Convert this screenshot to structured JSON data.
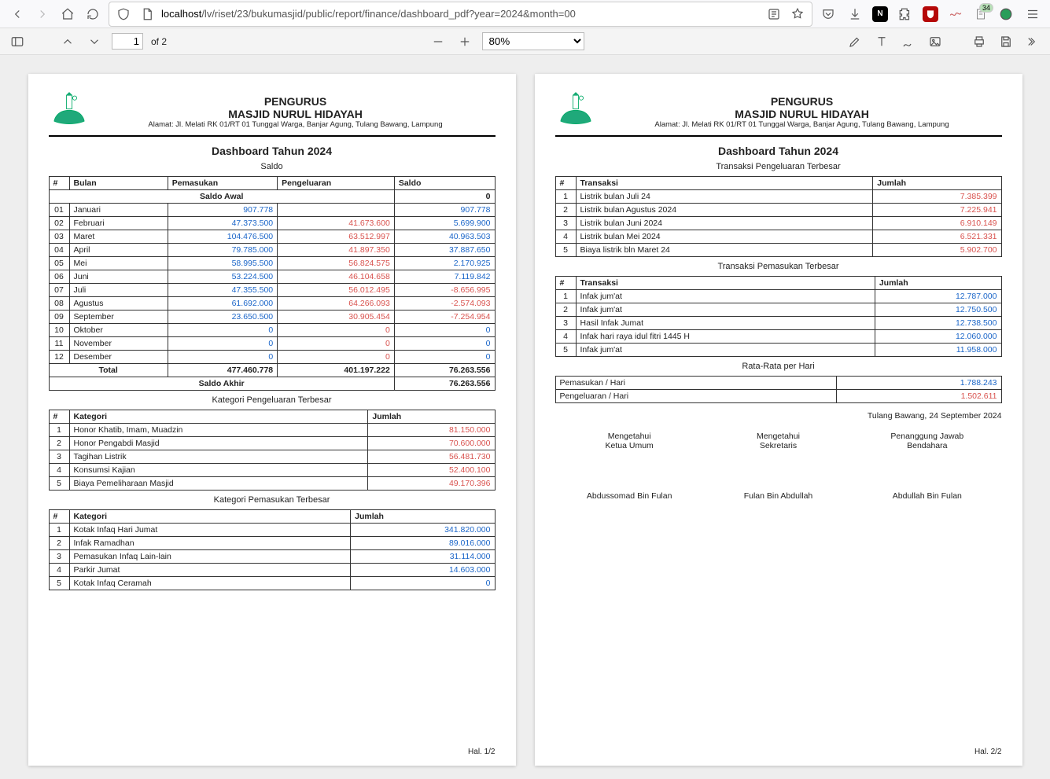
{
  "browser": {
    "url_prefix": "localhost",
    "url_path": "/lv/riset/23/bukumasjid/public/report/finance/dashboard_pdf?year=2024&month=00",
    "ext_badge": "34"
  },
  "pdfbar": {
    "page_current": "1",
    "page_total": "of 2",
    "zoom": "80%"
  },
  "letterhead": {
    "line1": "PENGURUS",
    "line2": "MASJID NURUL HIDAYAH",
    "addr": "Alamat: Jl. Melati RK 01/RT 01 Tunggal Warga, Banjar Agung, Tulang Bawang, Lampung"
  },
  "report_title": "Dashboard Tahun 2024",
  "page1": {
    "saldo_label": "Saldo",
    "saldo_headers": {
      "no": "#",
      "bulan": "Bulan",
      "masuk": "Pemasukan",
      "keluar": "Pengeluaran",
      "saldo": "Saldo"
    },
    "saldo_awal_label": "Saldo Awal",
    "saldo_awal_value": "0",
    "saldo_rows": [
      {
        "no": "01",
        "bulan": "Januari",
        "masuk": "907.778",
        "keluar": "",
        "saldo": "907.778"
      },
      {
        "no": "02",
        "bulan": "Februari",
        "masuk": "47.373.500",
        "keluar": "41.673.600",
        "saldo": "5.699.900"
      },
      {
        "no": "03",
        "bulan": "Maret",
        "masuk": "104.476.500",
        "keluar": "63.512.997",
        "saldo": "40.963.503"
      },
      {
        "no": "04",
        "bulan": "April",
        "masuk": "79.785.000",
        "keluar": "41.897.350",
        "saldo": "37.887.650"
      },
      {
        "no": "05",
        "bulan": "Mei",
        "masuk": "58.995.500",
        "keluar": "56.824.575",
        "saldo": "2.170.925"
      },
      {
        "no": "06",
        "bulan": "Juni",
        "masuk": "53.224.500",
        "keluar": "46.104.658",
        "saldo": "7.119.842"
      },
      {
        "no": "07",
        "bulan": "Juli",
        "masuk": "47.355.500",
        "keluar": "56.012.495",
        "saldo": "-8.656.995",
        "neg": true
      },
      {
        "no": "08",
        "bulan": "Agustus",
        "masuk": "61.692.000",
        "keluar": "64.266.093",
        "saldo": "-2.574.093",
        "neg": true
      },
      {
        "no": "09",
        "bulan": "September",
        "masuk": "23.650.500",
        "keluar": "30.905.454",
        "saldo": "-7.254.954",
        "neg": true
      },
      {
        "no": "10",
        "bulan": "Oktober",
        "masuk": "0",
        "keluar": "0",
        "saldo": "0"
      },
      {
        "no": "11",
        "bulan": "November",
        "masuk": "0",
        "keluar": "0",
        "saldo": "0"
      },
      {
        "no": "12",
        "bulan": "Desember",
        "masuk": "0",
        "keluar": "0",
        "saldo": "0"
      }
    ],
    "total_label": "Total",
    "total_masuk": "477.460.778",
    "total_keluar": "401.197.222",
    "total_saldo": "76.263.556",
    "saldo_akhir_label": "Saldo Akhir",
    "saldo_akhir_value": "76.263.556",
    "kat_keluar_title": "Kategori Pengeluaran Terbesar",
    "list_headers": {
      "no": "#",
      "kat": "Kategori",
      "jml": "Jumlah"
    },
    "kat_keluar": [
      {
        "no": "1",
        "kat": "Honor Khatib, Imam, Muadzin",
        "jml": "81.150.000"
      },
      {
        "no": "2",
        "kat": "Honor Pengabdi Masjid",
        "jml": "70.600.000"
      },
      {
        "no": "3",
        "kat": "Tagihan Listrik",
        "jml": "56.481.730"
      },
      {
        "no": "4",
        "kat": "Konsumsi Kajian",
        "jml": "52.400.100"
      },
      {
        "no": "5",
        "kat": "Biaya Pemeliharaan Masjid",
        "jml": "49.170.396"
      }
    ],
    "kat_masuk_title": "Kategori Pemasukan Terbesar",
    "kat_masuk": [
      {
        "no": "1",
        "kat": "Kotak Infaq Hari Jumat",
        "jml": "341.820.000"
      },
      {
        "no": "2",
        "kat": "Infak Ramadhan",
        "jml": "89.016.000"
      },
      {
        "no": "3",
        "kat": "Pemasukan Infaq Lain-lain",
        "jml": "31.114.000"
      },
      {
        "no": "4",
        "kat": "Parkir Jumat",
        "jml": "14.603.000"
      },
      {
        "no": "5",
        "kat": "Kotak Infaq Ceramah",
        "jml": "0"
      }
    ],
    "footer": "Hal. 1/2"
  },
  "page2": {
    "trx_keluar_title": "Transaksi Pengeluaran Terbesar",
    "trx_headers": {
      "no": "#",
      "trx": "Transaksi",
      "jml": "Jumlah"
    },
    "trx_keluar": [
      {
        "no": "1",
        "trx": "Listrik bulan Juli 24",
        "jml": "7.385.399"
      },
      {
        "no": "2",
        "trx": "Listrik bulan Agustus 2024",
        "jml": "7.225.941"
      },
      {
        "no": "3",
        "trx": "Listrik bulan Juni 2024",
        "jml": "6.910.149"
      },
      {
        "no": "4",
        "trx": "Listrik bulan Mei 2024",
        "jml": "6.521.331"
      },
      {
        "no": "5",
        "trx": "Biaya listrik bln Maret 24",
        "jml": "5.902.700"
      }
    ],
    "trx_masuk_title": "Transaksi Pemasukan Terbesar",
    "trx_masuk": [
      {
        "no": "1",
        "trx": "Infak jum'at",
        "jml": "12.787.000"
      },
      {
        "no": "2",
        "trx": "Infak jum'at",
        "jml": "12.750.500"
      },
      {
        "no": "3",
        "trx": "Hasil Infak Jumat",
        "jml": "12.738.500"
      },
      {
        "no": "4",
        "trx": "Infak hari raya idul fitri 1445 H",
        "jml": "12.060.000"
      },
      {
        "no": "5",
        "trx": "Infak jum'at",
        "jml": "11.958.000"
      }
    ],
    "avg_title": "Rata-Rata per Hari",
    "avg_in_label": "Pemasukan / Hari",
    "avg_in_value": "1.788.243",
    "avg_out_label": "Pengeluaran / Hari",
    "avg_out_value": "1.502.611",
    "date_line": "Tulang Bawang, 24 September 2024",
    "sig": {
      "col1_a": "Mengetahui",
      "col1_b": "Ketua Umum",
      "col1_name": "Abdussomad Bin Fulan",
      "col2_a": "Mengetahui",
      "col2_b": "Sekretaris",
      "col2_name": "Fulan Bin Abdullah",
      "col3_a": "Penanggung Jawab",
      "col3_b": "Bendahara",
      "col3_name": "Abdullah Bin Fulan"
    },
    "footer": "Hal. 2/2"
  }
}
